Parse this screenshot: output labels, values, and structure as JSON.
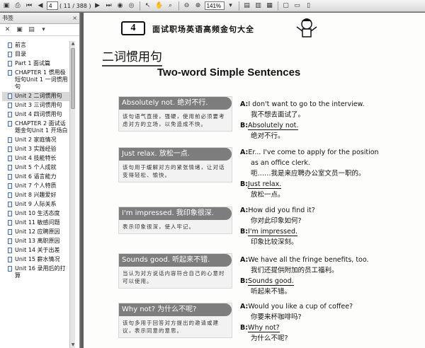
{
  "toolbar": {
    "page_value": "4",
    "page_count": "( 11 / 388 )",
    "zoom": "141%"
  },
  "bookmarks": {
    "title": "书签",
    "close": "×",
    "items": [
      {
        "label": "前言"
      },
      {
        "label": "目录"
      },
      {
        "label": "Part 1   面试篇"
      },
      {
        "label": "CHAPTER 1   惯用极短句Unit 1   一词惯用句"
      },
      {
        "label": "Unit 2   二词惯用句",
        "selected": true
      },
      {
        "label": "Unit 3   三词惯用句"
      },
      {
        "label": "Unit 4   四词惯用句"
      },
      {
        "label": "CHAPTER 2   面试话题金句Unit 1   开场白"
      },
      {
        "label": "Unit 2   家庭情况"
      },
      {
        "label": "Unit 3   实践经验"
      },
      {
        "label": "Unit 4   技能特长"
      },
      {
        "label": "Unit 5   个人成就"
      },
      {
        "label": "Unit 6   语言能力"
      },
      {
        "label": "Unit 7   个人特质"
      },
      {
        "label": "Unit 8   兴趣爱好"
      },
      {
        "label": "Unit 9   人际关系"
      },
      {
        "label": "Unit 10   生活态度"
      },
      {
        "label": "Unit 11   敏感问题"
      },
      {
        "label": "Unit 12   应聘原因"
      },
      {
        "label": "Unit 13   离职原因"
      },
      {
        "label": "Unit 14   关于出差"
      },
      {
        "label": "Unit 15   薪水情况"
      },
      {
        "label": "Unit 16   录用后的打算"
      }
    ]
  },
  "page": {
    "badge": "4",
    "header_title": "面试职场英语高频金句大全",
    "cn_title": "二词惯用句",
    "en_title": "Two-word Simple Sentences",
    "cards": [
      {
        "head": "Absolutely not. 绝对不行.",
        "body": "该句语气直接，强硬，使用前必须要考虑对方的立场，以免造成不快。"
      },
      {
        "head": "Just relax. 放松一点.",
        "body": "该句用于缓解对方的紧张情绪，让对话变得轻松、愉快。"
      },
      {
        "head": "I'm impressed. 我印象很深.",
        "body": "表示印象很深，使人牢记。"
      },
      {
        "head": "Sounds good. 听起来不错.",
        "body": "当认为对方说话内容符合自己的心意时可以使用。"
      },
      {
        "head": "Why not? 为什么不呢?",
        "body": "该句多用于回答对方提出的邀请或建议，表示同意的意思。"
      }
    ],
    "dialogs": [
      {
        "a_speaker": "A:",
        "a_en": "I don't want to go to the interview.",
        "a_cn": "我不想去面试了。",
        "b_speaker": "B:",
        "b_en": "Absolutely not.",
        "b_cn": "绝对不行。"
      },
      {
        "a_speaker": "A:",
        "a_en": "Er... I've come to apply for the position",
        "a_en2": "as an office clerk.",
        "a_cn": "呃……我是来应聘办公室文员一职的。",
        "b_speaker": "B:",
        "b_en": "Just relax.",
        "b_cn": "放松一点。"
      },
      {
        "a_speaker": "A:",
        "a_en": "How did you find it?",
        "a_cn": "你对此印象如何?",
        "b_speaker": "B:",
        "b_en": "I'm impressed.",
        "b_cn": "印象比较深刻。"
      },
      {
        "a_speaker": "A:",
        "a_en": "We have all the fringe benefits, too.",
        "a_cn": "我们还提供附加的员工福利。",
        "b_speaker": "B:",
        "b_en": "Sounds good.",
        "b_cn": "听起来不错。"
      },
      {
        "a_speaker": "A:",
        "a_en": "Would you like a cup of coffee?",
        "a_cn": "你要来杯咖啡吗?",
        "b_speaker": "B:",
        "b_en": "Why not?",
        "b_cn": "为什么不呢?"
      }
    ]
  }
}
